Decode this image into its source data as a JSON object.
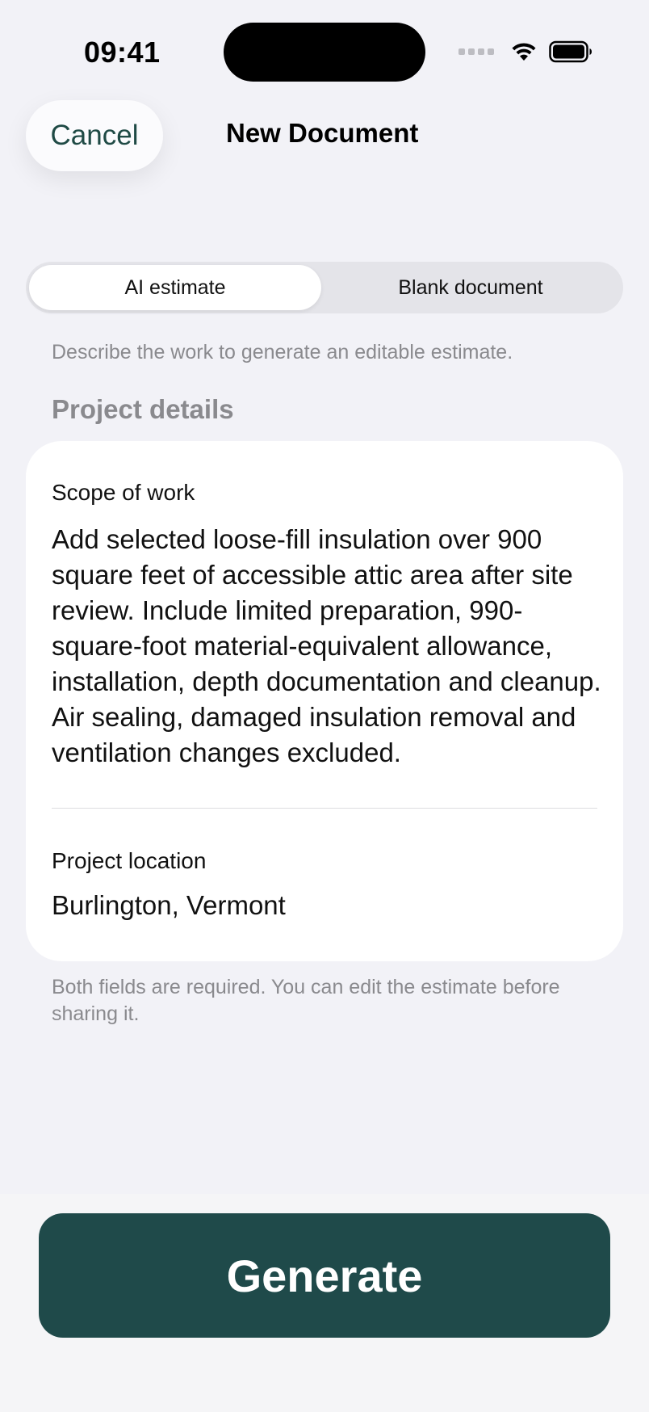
{
  "status_bar": {
    "time": "09:41"
  },
  "nav": {
    "cancel_label": "Cancel",
    "title": "New Document"
  },
  "segmented": {
    "options": [
      "AI estimate",
      "Blank document"
    ],
    "selected": "AI estimate"
  },
  "hint": "Describe the work to generate an editable estimate.",
  "section_title": "Project details",
  "form": {
    "scope_label": "Scope of work",
    "scope_value": "Add selected loose-fill insulation over 900 square feet of accessible attic area after site review. Include limited preparation, 990-square-foot material-equivalent allowance, installation, depth documentation and cleanup. Air sealing, damaged insulation removal and ventilation changes excluded.",
    "location_label": "Project location",
    "location_value": "Burlington, Vermont"
  },
  "footnote": "Both fields are required. You can edit the estimate before sharing it.",
  "generate_label": "Generate",
  "colors": {
    "accent": "#1f4a4a",
    "background": "#f2f2f7",
    "secondary_text": "#8a8a8e"
  },
  "icons": [
    "signal-icon",
    "wifi-icon",
    "battery-icon"
  ]
}
